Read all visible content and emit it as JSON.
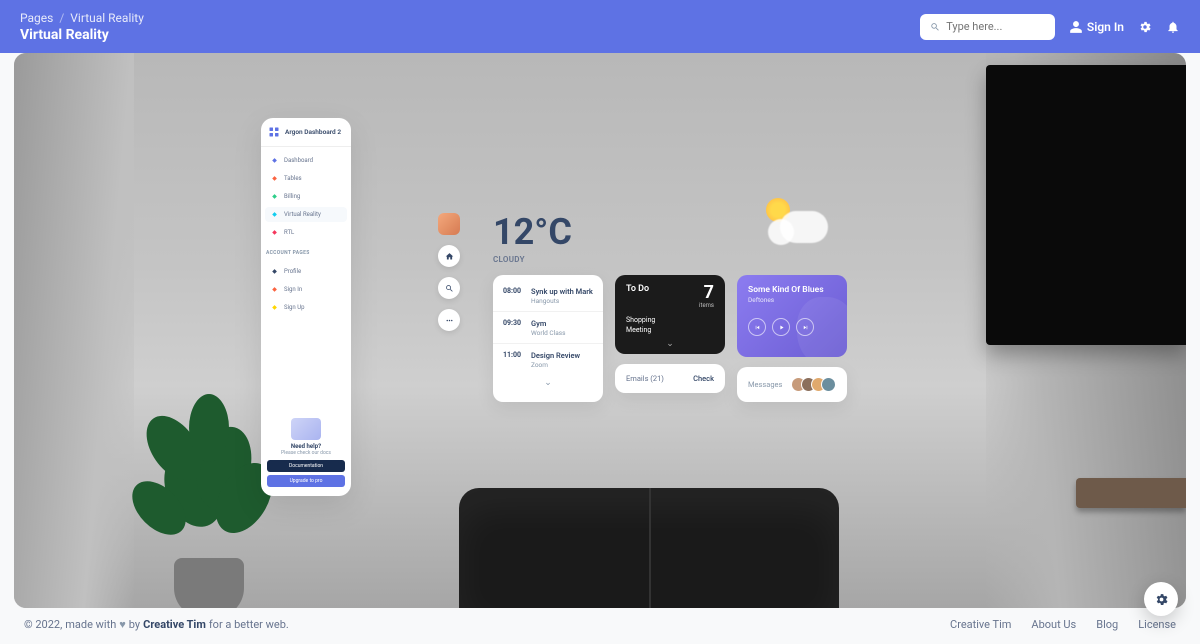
{
  "header": {
    "breadcrumb": {
      "root": "Pages",
      "current": "Virtual Reality"
    },
    "title": "Virtual Reality",
    "search_placeholder": "Type here...",
    "signin": "Sign In"
  },
  "sidebar": {
    "brand": "Argon Dashboard 2",
    "items": [
      {
        "label": "Dashboard",
        "color": "#5e72e4"
      },
      {
        "label": "Tables",
        "color": "#fb6340"
      },
      {
        "label": "Billing",
        "color": "#2dce89"
      },
      {
        "label": "Virtual Reality",
        "color": "#11cdef",
        "active": true
      },
      {
        "label": "RTL",
        "color": "#f5365c"
      }
    ],
    "section_label": "Account Pages",
    "account_items": [
      {
        "label": "Profile",
        "color": "#344767"
      },
      {
        "label": "Sign In",
        "color": "#fb6340"
      },
      {
        "label": "Sign Up",
        "color": "#ffd600"
      }
    ],
    "help": {
      "title": "Need help?",
      "subtitle": "Please check our docs",
      "btn1": "Documentation",
      "btn2": "Upgrade to pro"
    }
  },
  "weather": {
    "temp": "12°C",
    "condition": "Cloudy"
  },
  "schedule": [
    {
      "time": "08:00",
      "title": "Synk up with Mark",
      "sub": "Hangouts"
    },
    {
      "time": "09:30",
      "title": "Gym",
      "sub": "World Class"
    },
    {
      "time": "11:00",
      "title": "Design Review",
      "sub": "Zoom"
    }
  ],
  "todo": {
    "title": "To Do",
    "count": "7",
    "count_label": "items",
    "task1": "Shopping",
    "task2": "Meeting"
  },
  "emails": {
    "label": "Emails (21)",
    "action": "Check"
  },
  "music": {
    "title": "Some Kind Of Blues",
    "artist": "Deftones"
  },
  "messages": {
    "label": "Messages"
  },
  "footer": {
    "year": "© 2022,",
    "made": "made with",
    "by": "by",
    "author": "Creative Tim",
    "tagline": "for a better web.",
    "links": [
      "Creative Tim",
      "About Us",
      "Blog",
      "License"
    ]
  }
}
